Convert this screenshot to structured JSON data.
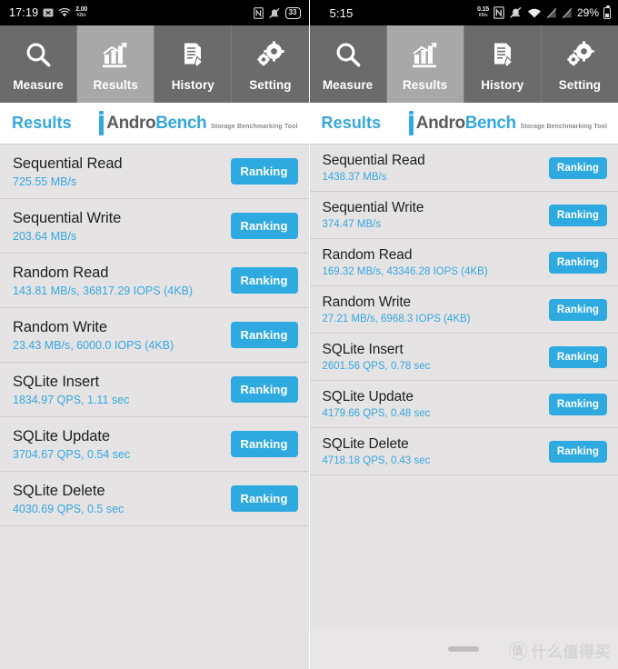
{
  "panels": [
    {
      "id": "left",
      "statusbar": {
        "clock": "17:19",
        "net_speed_value": "2.00",
        "net_speed_unit": "KB/s",
        "icons_left": [
          "x-box-icon",
          "wifi-icon",
          "net-speed-icon"
        ],
        "icons_right": [
          "nfc-icon",
          "vibrate-off-icon"
        ],
        "battery_level": "33"
      },
      "tabs": [
        {
          "label": "Measure",
          "icon": "magnifier-icon",
          "active": false
        },
        {
          "label": "Results",
          "icon": "bar-chart-icon",
          "active": true
        },
        {
          "label": "History",
          "icon": "document-pencil-icon",
          "active": false
        },
        {
          "label": "Setting",
          "icon": "gears-icon",
          "active": false
        }
      ],
      "title": "Results",
      "logo": {
        "part1": "Andro",
        "part2": "Bench",
        "subtitle": "Storage Benchmarking Tool"
      },
      "results": [
        {
          "name": "Sequential Read",
          "value": "725.55 MB/s",
          "button": "Ranking"
        },
        {
          "name": "Sequential Write",
          "value": "203.64 MB/s",
          "button": "Ranking"
        },
        {
          "name": "Random Read",
          "value": "143.81 MB/s, 36817.29 IOPS (4KB)",
          "button": "Ranking"
        },
        {
          "name": "Random Write",
          "value": "23.43 MB/s, 6000.0 IOPS (4KB)",
          "button": "Ranking"
        },
        {
          "name": "SQLite Insert",
          "value": "1834.97 QPS, 1.11 sec",
          "button": "Ranking"
        },
        {
          "name": "SQLite Update",
          "value": "3704.67 QPS, 0.54 sec",
          "button": "Ranking"
        },
        {
          "name": "SQLite Delete",
          "value": "4030.69 QPS, 0.5 sec",
          "button": "Ranking"
        }
      ]
    },
    {
      "id": "right",
      "statusbar": {
        "clock": "5:15",
        "net_speed_value": "0.15",
        "net_speed_unit": "KB/s",
        "icons_left": [],
        "icons_right": [
          "net-speed-icon",
          "nfc-icon",
          "vibrate-off-icon",
          "wifi-icon",
          "sim1-icon",
          "sim2-icon"
        ],
        "battery_percent": "29%"
      },
      "tabs": [
        {
          "label": "Measure",
          "icon": "magnifier-icon",
          "active": false
        },
        {
          "label": "Results",
          "icon": "bar-chart-icon",
          "active": true
        },
        {
          "label": "History",
          "icon": "document-pencil-icon",
          "active": false
        },
        {
          "label": "Setting",
          "icon": "gears-icon",
          "active": false
        }
      ],
      "title": "Results",
      "logo": {
        "part1": "Andro",
        "part2": "Bench",
        "subtitle": "Storage Benchmarking Tool"
      },
      "results": [
        {
          "name": "Sequential Read",
          "value": "1438.37 MB/s",
          "button": "Ranking"
        },
        {
          "name": "Sequential Write",
          "value": "374.47 MB/s",
          "button": "Ranking"
        },
        {
          "name": "Random Read",
          "value": "169.32 MB/s, 43346.28 IOPS (4KB)",
          "button": "Ranking"
        },
        {
          "name": "Random Write",
          "value": "27.21 MB/s, 6968.3 IOPS (4KB)",
          "button": "Ranking"
        },
        {
          "name": "SQLite Insert",
          "value": "2601.56 QPS, 0.78 sec",
          "button": "Ranking"
        },
        {
          "name": "SQLite Update",
          "value": "4179.66 QPS, 0.48 sec",
          "button": "Ranking"
        },
        {
          "name": "SQLite Delete",
          "value": "4718.18 QPS, 0.43 sec",
          "button": "Ranking"
        }
      ],
      "watermark": {
        "mark": "值",
        "text": "什么值得买"
      }
    }
  ],
  "colors": {
    "accent": "#35a8e0",
    "button": "#2eaae0",
    "tabbar": "#6b6b6b",
    "tab_active": "#a8a8a8",
    "list_bg": "#e5e3e3",
    "row_divider": "#cdcbcb",
    "statusbar": "#000000"
  }
}
